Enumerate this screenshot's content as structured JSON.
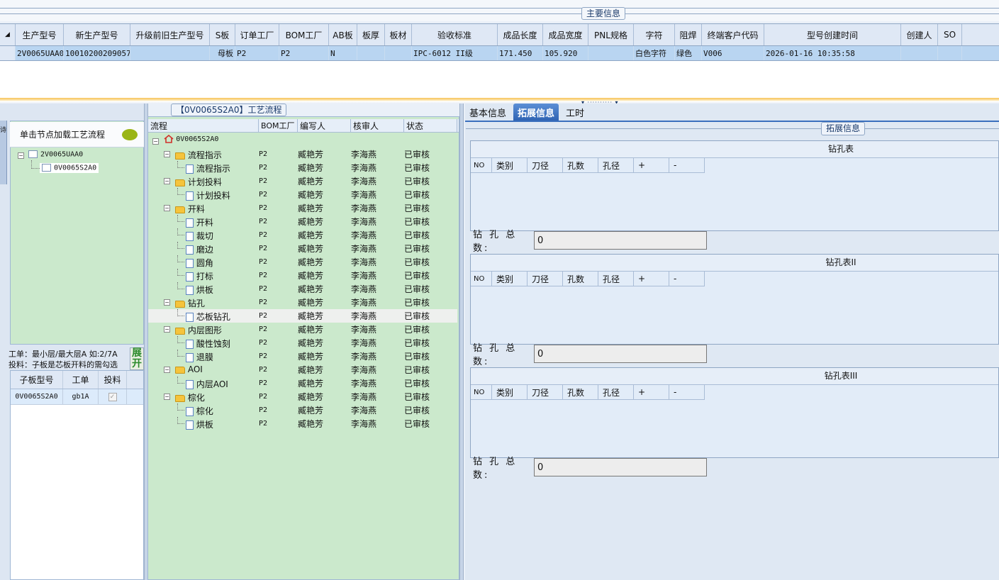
{
  "main_info": {
    "caption": "主要信息",
    "columns": [
      "生产型号",
      "新生产型号",
      "升级前旧生产型号",
      "S板",
      "订单工厂",
      "BOM工厂",
      "AB板",
      "板厚",
      "板材",
      "验收标准",
      "成品长度",
      "成品宽度",
      "PNL规格",
      "字符",
      "阻焊",
      "终端客户代码",
      "型号创建时间",
      "创建人",
      "SO"
    ],
    "row": [
      "2V0065UAA0",
      "10010200209057",
      "",
      "母板",
      "P2",
      "P2",
      "N",
      "",
      "",
      "IPC-6012 II级",
      "171.450",
      "105.920",
      "",
      "白色字符",
      "绿色",
      "V006",
      "2026-01-16 10:35:58",
      "",
      ""
    ]
  },
  "left": {
    "vtab_label": "诗",
    "tree_header": "单击节点加载工艺流程",
    "tree_items": [
      "2V0065UAA0",
      "0V0065S2A0"
    ],
    "info_line1": "工单：最小层/最大层A 如:2/7A",
    "info_line2": "投料：子板是芯板开料的需勾选",
    "expand_label": "展开",
    "sub_columns": [
      "子板型号",
      "工单",
      "投料"
    ],
    "sub_rows": [
      [
        "0V0065S2A0",
        "gb1A",
        "✓"
      ]
    ]
  },
  "flow": {
    "caption": "【0V0065S2A0】工艺流程",
    "columns": [
      "流程",
      "BOM工厂",
      "编写人",
      "核审人",
      "状态"
    ],
    "root": "0V0065S2A0",
    "rows": [
      {
        "name": "流程指示",
        "type": "folder",
        "bom": "P2",
        "writer": "臧艳芳",
        "checker": "李海燕",
        "status": "已审核"
      },
      {
        "name": "流程指示",
        "type": "doc",
        "bom": "P2",
        "writer": "臧艳芳",
        "checker": "李海燕",
        "status": "已审核"
      },
      {
        "name": "计划投料",
        "type": "folder",
        "bom": "P2",
        "writer": "臧艳芳",
        "checker": "李海燕",
        "status": "已审核"
      },
      {
        "name": "计划投料",
        "type": "doc",
        "bom": "P2",
        "writer": "臧艳芳",
        "checker": "李海燕",
        "status": "已审核"
      },
      {
        "name": "开料",
        "type": "folder",
        "bom": "P2",
        "writer": "臧艳芳",
        "checker": "李海燕",
        "status": "已审核"
      },
      {
        "name": "开料",
        "type": "doc",
        "bom": "P2",
        "writer": "臧艳芳",
        "checker": "李海燕",
        "status": "已审核"
      },
      {
        "name": "裁切",
        "type": "doc",
        "bom": "P2",
        "writer": "臧艳芳",
        "checker": "李海燕",
        "status": "已审核"
      },
      {
        "name": "磨边",
        "type": "doc",
        "bom": "P2",
        "writer": "臧艳芳",
        "checker": "李海燕",
        "status": "已审核"
      },
      {
        "name": "圆角",
        "type": "doc",
        "bom": "P2",
        "writer": "臧艳芳",
        "checker": "李海燕",
        "status": "已审核"
      },
      {
        "name": "打标",
        "type": "doc",
        "bom": "P2",
        "writer": "臧艳芳",
        "checker": "李海燕",
        "status": "已审核"
      },
      {
        "name": "烘板",
        "type": "doc",
        "bom": "P2",
        "writer": "臧艳芳",
        "checker": "李海燕",
        "status": "已审核"
      },
      {
        "name": "钻孔",
        "type": "folder",
        "bom": "P2",
        "writer": "臧艳芳",
        "checker": "李海燕",
        "status": "已审核"
      },
      {
        "name": "芯板钻孔",
        "type": "doc",
        "bom": "P2",
        "writer": "臧艳芳",
        "checker": "李海燕",
        "status": "已审核"
      },
      {
        "name": "内层图形",
        "type": "folder",
        "bom": "P2",
        "writer": "臧艳芳",
        "checker": "李海燕",
        "status": "已审核"
      },
      {
        "name": "酸性蚀刻",
        "type": "doc",
        "bom": "P2",
        "writer": "臧艳芳",
        "checker": "李海燕",
        "status": "已审核"
      },
      {
        "name": "退膜",
        "type": "doc",
        "bom": "P2",
        "writer": "臧艳芳",
        "checker": "李海燕",
        "status": "已审核"
      },
      {
        "name": "AOI",
        "type": "folder",
        "bom": "P2",
        "writer": "臧艳芳",
        "checker": "李海燕",
        "status": "已审核"
      },
      {
        "name": "内层AOI",
        "type": "doc",
        "bom": "P2",
        "writer": "臧艳芳",
        "checker": "李海燕",
        "status": "已审核"
      },
      {
        "name": "棕化",
        "type": "folder",
        "bom": "P2",
        "writer": "臧艳芳",
        "checker": "李海燕",
        "status": "已审核"
      },
      {
        "name": "棕化",
        "type": "doc",
        "bom": "P2",
        "writer": "臧艳芳",
        "checker": "李海燕",
        "status": "已审核"
      },
      {
        "name": "烘板",
        "type": "doc",
        "bom": "P2",
        "writer": "臧艳芳",
        "checker": "李海燕",
        "status": "已审核"
      }
    ]
  },
  "right": {
    "tabs": [
      "基本信息",
      "拓展信息",
      "工时"
    ],
    "active_tab": "拓展信息",
    "caption": "拓展信息",
    "grid_columns": [
      "NO",
      "类别",
      "刀径",
      "孔数",
      "孔径",
      "+",
      "-"
    ],
    "grids": [
      {
        "title": "钻孔表",
        "total_label": "钻 孔 总 数:",
        "total": "0"
      },
      {
        "title": "钻孔表II",
        "total_label": "钻 孔 总 数:",
        "total": "0"
      },
      {
        "title": "钻孔表III",
        "total_label": "钻 孔 总 数:",
        "total": "0"
      }
    ]
  },
  "colors": {
    "selected_row": "#b9d5f1",
    "tree_bg": "#cbe9cc",
    "tab_active": "#2f63b3",
    "splitter": "#f7c35a"
  }
}
